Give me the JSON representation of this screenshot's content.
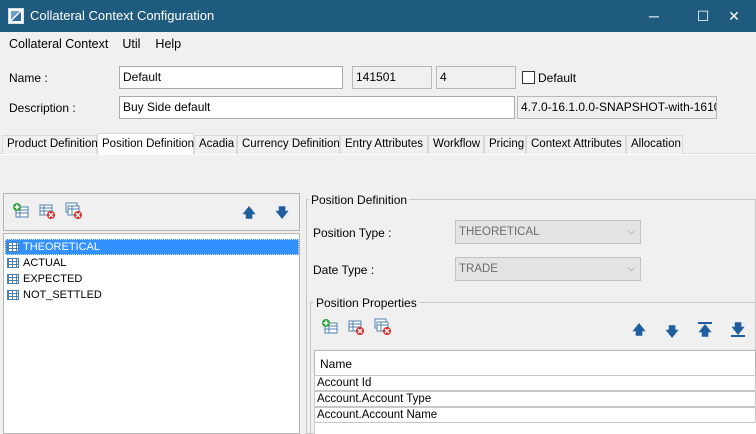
{
  "window": {
    "title": "Collateral Context Configuration",
    "minimize": "─",
    "maximize": "☐",
    "close": "✕"
  },
  "menu": [
    "Collateral Context",
    "Util",
    "Help"
  ],
  "form": {
    "name_label": "Name :",
    "name_value": "Default",
    "id_value": "141501",
    "version_value": "4",
    "default_label": "Default",
    "default_checked": false,
    "description_label": "Description :",
    "description_value": "Buy Side default",
    "build_value": "4.7.0-16.1.0.0-SNAPSHOT-with-1610"
  },
  "tabs": [
    "Product Definition",
    "Position Definition",
    "Acadia",
    "Currency Definition",
    "Entry Attributes",
    "Workflow",
    "Pricing",
    "Context Attributes",
    "Allocation"
  ],
  "active_tab": "Position Definition",
  "position_list": [
    "THEORETICAL",
    "ACTUAL",
    "EXPECTED",
    "NOT_SETTLED"
  ],
  "selected_position": "THEORETICAL",
  "position_definition": {
    "group_title": "Position Definition",
    "type_label": "Position Type :",
    "type_value": "THEORETICAL",
    "date_label": "Date Type :",
    "date_value": "TRADE"
  },
  "position_properties": {
    "group_title": "Position Properties",
    "column": "Name",
    "rows": [
      "Account Id",
      "Account.Account Type",
      "Account.Account Name"
    ]
  },
  "colors": {
    "titlebar": "#1f5a7f",
    "selection": "#3390ff",
    "arrow": "#1f5f9f"
  }
}
